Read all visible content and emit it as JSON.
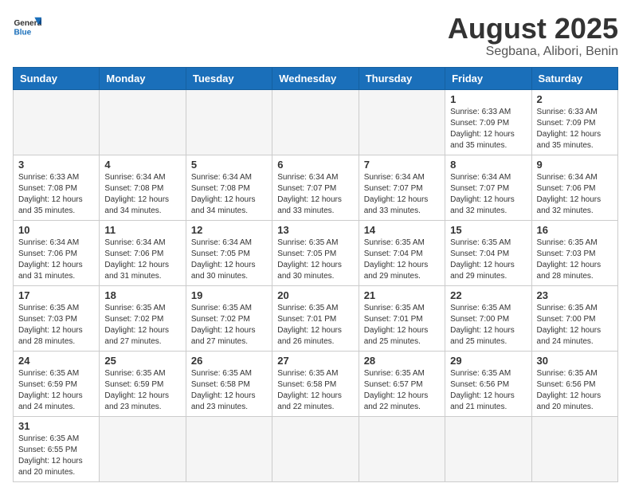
{
  "header": {
    "logo_general": "General",
    "logo_blue": "Blue",
    "month_title": "August 2025",
    "location": "Segbana, Alibori, Benin"
  },
  "days_of_week": [
    "Sunday",
    "Monday",
    "Tuesday",
    "Wednesday",
    "Thursday",
    "Friday",
    "Saturday"
  ],
  "weeks": [
    [
      {
        "day": "",
        "info": ""
      },
      {
        "day": "",
        "info": ""
      },
      {
        "day": "",
        "info": ""
      },
      {
        "day": "",
        "info": ""
      },
      {
        "day": "",
        "info": ""
      },
      {
        "day": "1",
        "info": "Sunrise: 6:33 AM\nSunset: 7:09 PM\nDaylight: 12 hours and 35 minutes."
      },
      {
        "day": "2",
        "info": "Sunrise: 6:33 AM\nSunset: 7:09 PM\nDaylight: 12 hours and 35 minutes."
      }
    ],
    [
      {
        "day": "3",
        "info": "Sunrise: 6:33 AM\nSunset: 7:08 PM\nDaylight: 12 hours and 35 minutes."
      },
      {
        "day": "4",
        "info": "Sunrise: 6:34 AM\nSunset: 7:08 PM\nDaylight: 12 hours and 34 minutes."
      },
      {
        "day": "5",
        "info": "Sunrise: 6:34 AM\nSunset: 7:08 PM\nDaylight: 12 hours and 34 minutes."
      },
      {
        "day": "6",
        "info": "Sunrise: 6:34 AM\nSunset: 7:07 PM\nDaylight: 12 hours and 33 minutes."
      },
      {
        "day": "7",
        "info": "Sunrise: 6:34 AM\nSunset: 7:07 PM\nDaylight: 12 hours and 33 minutes."
      },
      {
        "day": "8",
        "info": "Sunrise: 6:34 AM\nSunset: 7:07 PM\nDaylight: 12 hours and 32 minutes."
      },
      {
        "day": "9",
        "info": "Sunrise: 6:34 AM\nSunset: 7:06 PM\nDaylight: 12 hours and 32 minutes."
      }
    ],
    [
      {
        "day": "10",
        "info": "Sunrise: 6:34 AM\nSunset: 7:06 PM\nDaylight: 12 hours and 31 minutes."
      },
      {
        "day": "11",
        "info": "Sunrise: 6:34 AM\nSunset: 7:06 PM\nDaylight: 12 hours and 31 minutes."
      },
      {
        "day": "12",
        "info": "Sunrise: 6:34 AM\nSunset: 7:05 PM\nDaylight: 12 hours and 30 minutes."
      },
      {
        "day": "13",
        "info": "Sunrise: 6:35 AM\nSunset: 7:05 PM\nDaylight: 12 hours and 30 minutes."
      },
      {
        "day": "14",
        "info": "Sunrise: 6:35 AM\nSunset: 7:04 PM\nDaylight: 12 hours and 29 minutes."
      },
      {
        "day": "15",
        "info": "Sunrise: 6:35 AM\nSunset: 7:04 PM\nDaylight: 12 hours and 29 minutes."
      },
      {
        "day": "16",
        "info": "Sunrise: 6:35 AM\nSunset: 7:03 PM\nDaylight: 12 hours and 28 minutes."
      }
    ],
    [
      {
        "day": "17",
        "info": "Sunrise: 6:35 AM\nSunset: 7:03 PM\nDaylight: 12 hours and 28 minutes."
      },
      {
        "day": "18",
        "info": "Sunrise: 6:35 AM\nSunset: 7:02 PM\nDaylight: 12 hours and 27 minutes."
      },
      {
        "day": "19",
        "info": "Sunrise: 6:35 AM\nSunset: 7:02 PM\nDaylight: 12 hours and 27 minutes."
      },
      {
        "day": "20",
        "info": "Sunrise: 6:35 AM\nSunset: 7:01 PM\nDaylight: 12 hours and 26 minutes."
      },
      {
        "day": "21",
        "info": "Sunrise: 6:35 AM\nSunset: 7:01 PM\nDaylight: 12 hours and 25 minutes."
      },
      {
        "day": "22",
        "info": "Sunrise: 6:35 AM\nSunset: 7:00 PM\nDaylight: 12 hours and 25 minutes."
      },
      {
        "day": "23",
        "info": "Sunrise: 6:35 AM\nSunset: 7:00 PM\nDaylight: 12 hours and 24 minutes."
      }
    ],
    [
      {
        "day": "24",
        "info": "Sunrise: 6:35 AM\nSunset: 6:59 PM\nDaylight: 12 hours and 24 minutes."
      },
      {
        "day": "25",
        "info": "Sunrise: 6:35 AM\nSunset: 6:59 PM\nDaylight: 12 hours and 23 minutes."
      },
      {
        "day": "26",
        "info": "Sunrise: 6:35 AM\nSunset: 6:58 PM\nDaylight: 12 hours and 23 minutes."
      },
      {
        "day": "27",
        "info": "Sunrise: 6:35 AM\nSunset: 6:58 PM\nDaylight: 12 hours and 22 minutes."
      },
      {
        "day": "28",
        "info": "Sunrise: 6:35 AM\nSunset: 6:57 PM\nDaylight: 12 hours and 22 minutes."
      },
      {
        "day": "29",
        "info": "Sunrise: 6:35 AM\nSunset: 6:56 PM\nDaylight: 12 hours and 21 minutes."
      },
      {
        "day": "30",
        "info": "Sunrise: 6:35 AM\nSunset: 6:56 PM\nDaylight: 12 hours and 20 minutes."
      }
    ],
    [
      {
        "day": "31",
        "info": "Sunrise: 6:35 AM\nSunset: 6:55 PM\nDaylight: 12 hours and 20 minutes."
      },
      {
        "day": "",
        "info": ""
      },
      {
        "day": "",
        "info": ""
      },
      {
        "day": "",
        "info": ""
      },
      {
        "day": "",
        "info": ""
      },
      {
        "day": "",
        "info": ""
      },
      {
        "day": "",
        "info": ""
      }
    ]
  ],
  "accent_color": "#1a6fba"
}
